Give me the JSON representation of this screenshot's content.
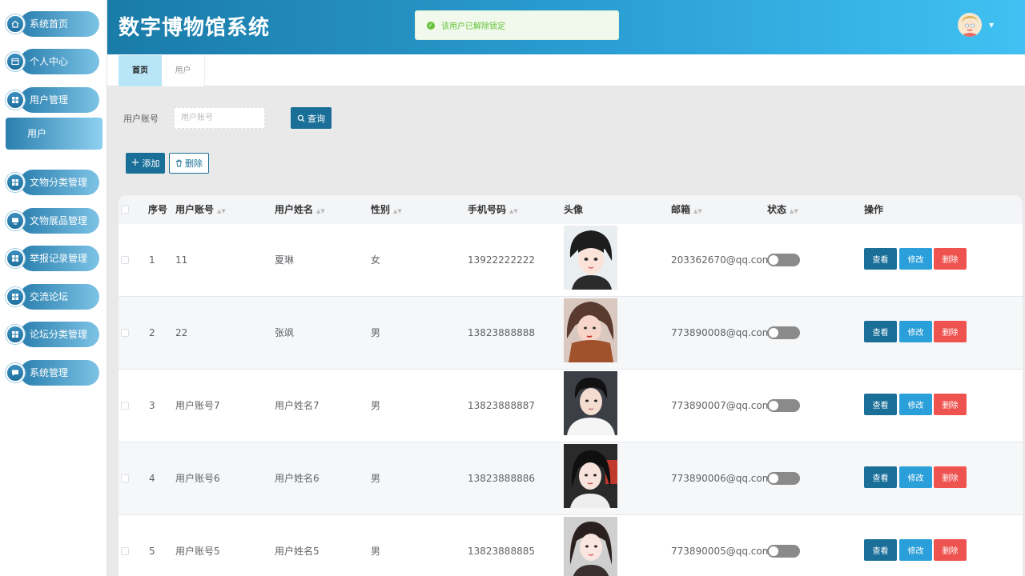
{
  "sidebar": {
    "items": [
      {
        "label": "系统首页",
        "icon": "home-icon"
      },
      {
        "label": "个人中心",
        "icon": "profile-icon"
      },
      {
        "label": "用户管理",
        "icon": "grid-icon",
        "submenu": [
          "用户"
        ]
      },
      {
        "label": "文物分类管理",
        "icon": "grid-icon"
      },
      {
        "label": "文物展品管理",
        "icon": "monitor-icon"
      },
      {
        "label": "举报记录管理",
        "icon": "grid-icon"
      },
      {
        "label": "交流论坛",
        "icon": "grid-icon"
      },
      {
        "label": "论坛分类管理",
        "icon": "grid-icon"
      },
      {
        "label": "系统管理",
        "icon": "chat-icon"
      }
    ]
  },
  "header": {
    "title": "数字博物馆系统",
    "toast": "该用户已解除锁定"
  },
  "tabs": [
    {
      "label": "首页",
      "active": true
    },
    {
      "label": "用户",
      "active": false
    }
  ],
  "search": {
    "label": "用户账号",
    "placeholder": "用户账号",
    "value": "",
    "button": "查询"
  },
  "actions": {
    "add": "添加",
    "delete": "删除"
  },
  "table": {
    "columns": [
      "序号",
      "用户账号",
      "用户姓名",
      "性别",
      "手机号码",
      "头像",
      "邮箱",
      "状态",
      "操作"
    ],
    "rows": [
      {
        "index": "1",
        "account": "11",
        "name": "夏琳",
        "gender": "女",
        "phone": "13922222222",
        "email": "203362670@qq.com",
        "enabled": false
      },
      {
        "index": "2",
        "account": "22",
        "name": "张飒",
        "gender": "男",
        "phone": "13823888888",
        "email": "773890008@qq.com",
        "enabled": false
      },
      {
        "index": "3",
        "account": "用户账号7",
        "name": "用户姓名7",
        "gender": "男",
        "phone": "13823888887",
        "email": "773890007@qq.com",
        "enabled": false
      },
      {
        "index": "4",
        "account": "用户账号6",
        "name": "用户姓名6",
        "gender": "男",
        "phone": "13823888886",
        "email": "773890006@qq.com",
        "enabled": false
      },
      {
        "index": "5",
        "account": "用户账号5",
        "name": "用户姓名5",
        "gender": "男",
        "phone": "13823888885",
        "email": "773890005@qq.com",
        "enabled": false
      }
    ],
    "row_actions": {
      "view": "查看",
      "edit": "修改",
      "delete": "删除"
    }
  },
  "colors": {
    "primary": "#1a6f98",
    "info": "#2b9fd9",
    "danger": "#ef5350",
    "success": "#67c23a"
  }
}
